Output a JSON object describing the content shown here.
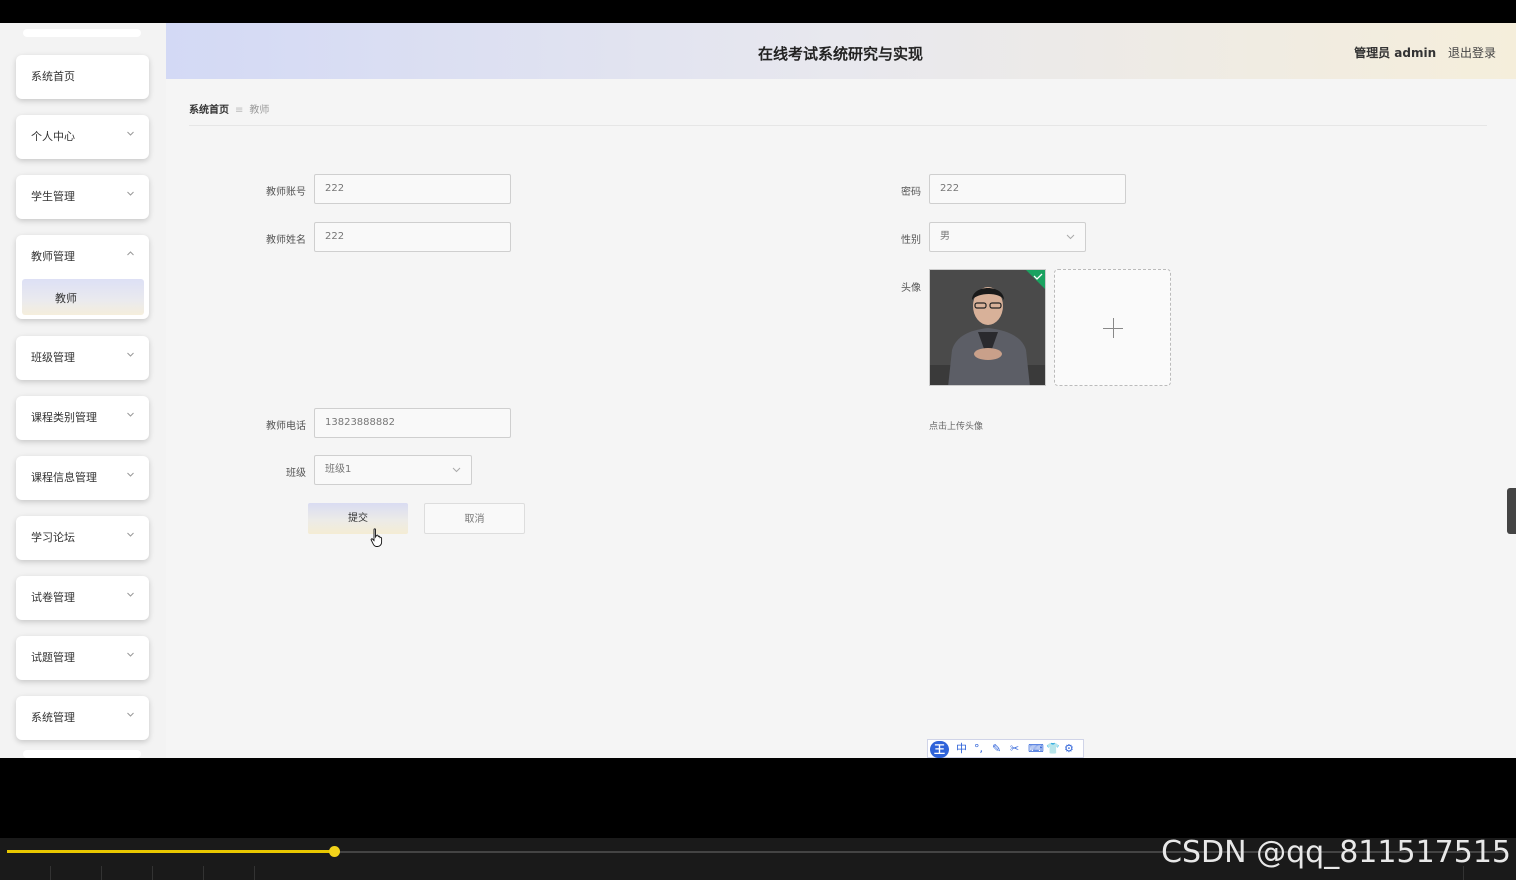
{
  "header": {
    "title": "在线考试系统研究与实现",
    "user_label": "管理员 admin",
    "logout_label": "退出登录"
  },
  "sidebar": {
    "items": [
      {
        "label": "系统首页"
      },
      {
        "label": "个人中心"
      },
      {
        "label": "学生管理"
      },
      {
        "label": "教师管理",
        "expanded": true,
        "children": [
          {
            "label": "教师"
          }
        ]
      },
      {
        "label": "班级管理"
      },
      {
        "label": "课程类别管理"
      },
      {
        "label": "课程信息管理"
      },
      {
        "label": "学习论坛"
      },
      {
        "label": "试卷管理"
      },
      {
        "label": "试题管理"
      },
      {
        "label": "系统管理"
      }
    ]
  },
  "breadcrumb": {
    "home": "系统首页",
    "separator": "≡",
    "current": "教师"
  },
  "form": {
    "account": {
      "label": "教师账号",
      "value": "222"
    },
    "password": {
      "label": "密码",
      "value": "222"
    },
    "name": {
      "label": "教师姓名",
      "value": "222"
    },
    "gender": {
      "label": "性别",
      "value": "男"
    },
    "avatar": {
      "label": "头像",
      "hint": "点击上传头像"
    },
    "phone": {
      "label": "教师电话",
      "value": "13823888882"
    },
    "class": {
      "label": "班级",
      "value": "班级1"
    },
    "submit_label": "提交",
    "cancel_label": "取消"
  },
  "ime_toolbar": {
    "logo": "王",
    "mode": "中",
    "items": [
      "°,",
      "✎",
      "✂",
      "⌨",
      "👕",
      "⚙"
    ]
  },
  "watermark": "CSDN @qq_811517515",
  "player": {
    "progress": 0.218
  },
  "colors": {
    "accent_blue": "#d3d9f5",
    "accent_gold": "#f5eedb",
    "ime_blue": "#2f63d9",
    "progress": "#e8c700"
  }
}
